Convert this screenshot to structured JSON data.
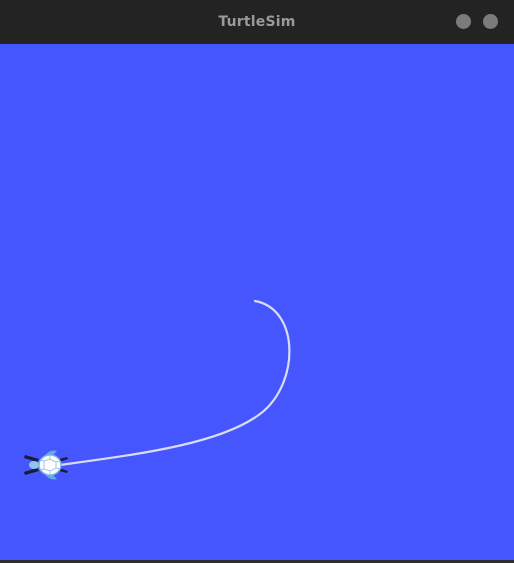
{
  "window": {
    "title": "TurtleSim",
    "titlebar_color": "#232323",
    "title_color": "#9a9a9a",
    "controls": [
      {
        "name": "minimize",
        "icon": "circle-icon",
        "color": "#7b7b7b"
      },
      {
        "name": "close",
        "icon": "circle-icon",
        "color": "#7b7b7b"
      }
    ]
  },
  "sim": {
    "background_color": "#4556ff",
    "pen_color": "#d8dcf5",
    "turtle": {
      "icon": "turtle-icon",
      "heading": "west",
      "shell_color": "#ffffff",
      "shell_outline_color": "#7fb4e0",
      "flipper_color": "#66a8e0",
      "foot_color": "#1a1a3a"
    }
  }
}
